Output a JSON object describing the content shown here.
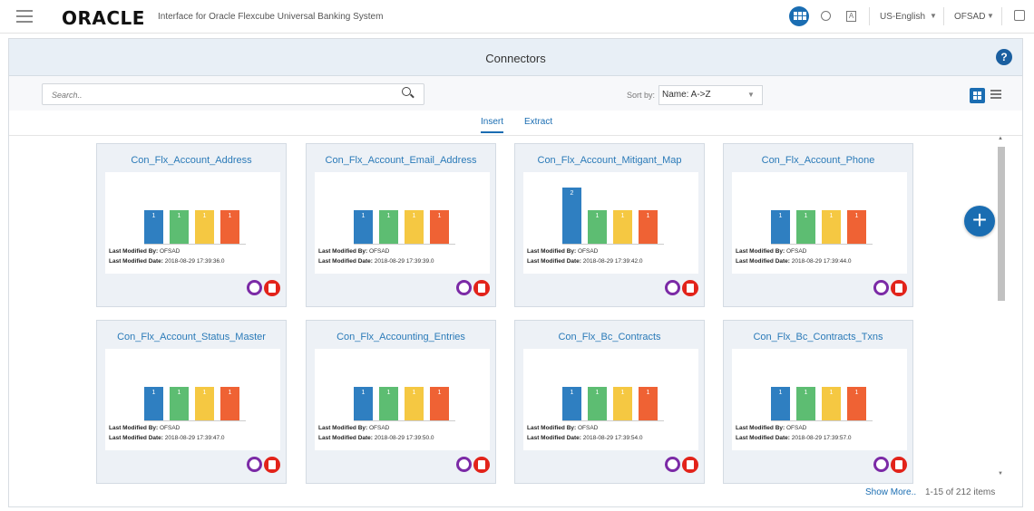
{
  "header": {
    "brand": "ORACLE",
    "app_title": "Interface for Oracle Flexcube Universal Banking System",
    "language": "US-English",
    "user": "OFSAD",
    "accessibility_glyph": "A"
  },
  "panel": {
    "title": "Connectors",
    "help_label": "?",
    "search_placeholder": "Search..",
    "sort_label": "Sort by:",
    "sort_value": "Name: A->Z",
    "tabs": [
      "Insert",
      "Extract"
    ],
    "active_tab": "Insert",
    "add_label": "+",
    "show_more": "Show More..",
    "count_text": "1-15 of 212 items"
  },
  "meta_labels": {
    "modified_by": "Last Modified By:",
    "modified_date": "Last Modified Date:"
  },
  "bar_colors": [
    "#2f7fc1",
    "#5dbd72",
    "#f5c842",
    "#ef6234"
  ],
  "cards": [
    {
      "title": "Con_Flx_Account_Address",
      "values": [
        1,
        1,
        1,
        1
      ],
      "by": "OFSAD",
      "date": "2018-08-29 17:39:36.0"
    },
    {
      "title": "Con_Flx_Account_Email_Address",
      "values": [
        1,
        1,
        1,
        1
      ],
      "by": "OFSAD",
      "date": "2018-08-29 17:39:39.0"
    },
    {
      "title": "Con_Flx_Account_Mitigant_Map",
      "values": [
        2,
        1,
        1,
        1
      ],
      "by": "OFSAD",
      "date": "2018-08-29 17:39:42.0"
    },
    {
      "title": "Con_Flx_Account_Phone",
      "values": [
        1,
        1,
        1,
        1
      ],
      "by": "OFSAD",
      "date": "2018-08-29 17:39:44.0"
    },
    {
      "title": "Con_Flx_Account_Status_Master",
      "values": [
        1,
        1,
        1,
        1
      ],
      "by": "OFSAD",
      "date": "2018-08-29 17:39:47.0"
    },
    {
      "title": "Con_Flx_Accounting_Entries",
      "values": [
        1,
        1,
        1,
        1
      ],
      "by": "OFSAD",
      "date": "2018-08-29 17:39:50.0"
    },
    {
      "title": "Con_Flx_Bc_Contracts",
      "values": [
        1,
        1,
        1,
        1
      ],
      "by": "OFSAD",
      "date": "2018-08-29 17:39:54.0"
    },
    {
      "title": "Con_Flx_Bc_Contracts_Txns",
      "values": [
        1,
        1,
        1,
        1
      ],
      "by": "OFSAD",
      "date": "2018-08-29 17:39:57.0"
    }
  ]
}
